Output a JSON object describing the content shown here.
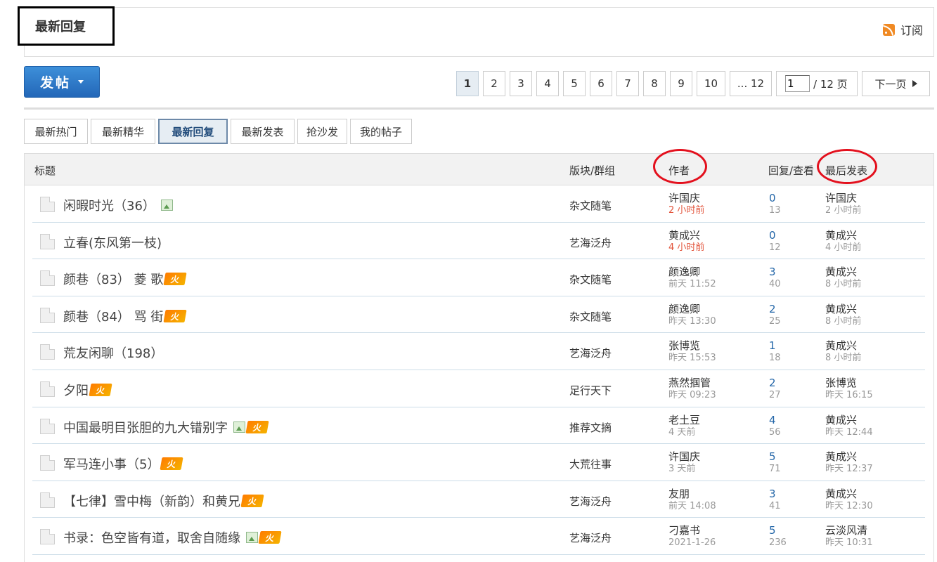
{
  "page": {
    "title": "最新回复",
    "subscribe": "订阅"
  },
  "post_button": {
    "label": "发帖"
  },
  "pagination": {
    "pages": [
      "1",
      "2",
      "3",
      "4",
      "5",
      "6",
      "7",
      "8",
      "9",
      "10",
      "... 12"
    ],
    "current_input": "1",
    "total": "/ 12 页",
    "next": "下一页"
  },
  "filters": [
    "最新热门",
    "最新精华",
    "最新回复",
    "最新发表",
    "抢沙发",
    "我的帖子"
  ],
  "table": {
    "headers": {
      "title": "标题",
      "board": "版块/群组",
      "author": "作者",
      "reply_view": "回复/查看",
      "last_post": "最后发表"
    },
    "rows": [
      {
        "title": "闲暇时光（36）",
        "img": true,
        "hot": false,
        "board": "杂文随笔",
        "author": "许国庆",
        "author_time": "2 小时前",
        "author_new": true,
        "replies": "0",
        "views": "13",
        "last_author": "许国庆",
        "last_time": "2 小时前"
      },
      {
        "title": "立春(东风第一枝)",
        "img": false,
        "hot": false,
        "board": "艺海泛舟",
        "author": "黄成兴",
        "author_time": "4 小时前",
        "author_new": true,
        "replies": "0",
        "views": "12",
        "last_author": "黄成兴",
        "last_time": "4 小时前"
      },
      {
        "title": "颜巷（83）  菱 歌",
        "img": false,
        "hot": true,
        "board": "杂文随笔",
        "author": "颜逸卿",
        "author_time": "前天 11:52",
        "author_new": false,
        "replies": "3",
        "views": "40",
        "last_author": "黄成兴",
        "last_time": "8 小时前"
      },
      {
        "title": "颜巷（84）  骂 街",
        "img": false,
        "hot": true,
        "board": "杂文随笔",
        "author": "颜逸卿",
        "author_time": "昨天 13:30",
        "author_new": false,
        "replies": "2",
        "views": "25",
        "last_author": "黄成兴",
        "last_time": "8 小时前"
      },
      {
        "title": "荒友闲聊（198）",
        "img": false,
        "hot": false,
        "board": "艺海泛舟",
        "author": "张博览",
        "author_time": "昨天 15:53",
        "author_new": false,
        "replies": "1",
        "views": "18",
        "last_author": "黄成兴",
        "last_time": "8 小时前"
      },
      {
        "title": "夕阳",
        "img": false,
        "hot": true,
        "board": "足行天下",
        "author": "燕然掴管",
        "author_time": "昨天 09:23",
        "author_new": false,
        "replies": "2",
        "views": "27",
        "last_author": "张博览",
        "last_time": "昨天 16:15"
      },
      {
        "title": "中国最明目张胆的九大错别字",
        "img": true,
        "hot": true,
        "board": "推荐文摘",
        "author": "老土豆",
        "author_time": "4 天前",
        "author_new": false,
        "replies": "4",
        "views": "56",
        "last_author": "黄成兴",
        "last_time": "昨天 12:44"
      },
      {
        "title": "军马连小事（5）",
        "img": false,
        "hot": true,
        "board": "大荒往事",
        "author": "许国庆",
        "author_time": "3 天前",
        "author_new": false,
        "replies": "5",
        "views": "71",
        "last_author": "黄成兴",
        "last_time": "昨天 12:37"
      },
      {
        "title": "【七律】雪中梅（新韵）和黄兄",
        "img": false,
        "hot": true,
        "board": "艺海泛舟",
        "author": "友朋",
        "author_time": "前天 14:08",
        "author_new": false,
        "replies": "3",
        "views": "41",
        "last_author": "黄成兴",
        "last_time": "昨天 12:30"
      },
      {
        "title": "书录：色空皆有道，取舍自随缘",
        "img": true,
        "hot": true,
        "board": "艺海泛舟",
        "author": "刁嘉书",
        "author_time": "2021-1-26",
        "author_new": false,
        "replies": "5",
        "views": "236",
        "last_author": "云淡风清",
        "last_time": "昨天 10:31"
      }
    ]
  },
  "colors": {
    "primary": "#2a70c0",
    "link": "#2366a8",
    "annotation": "#e3101d",
    "new_time": "#e2533a"
  }
}
